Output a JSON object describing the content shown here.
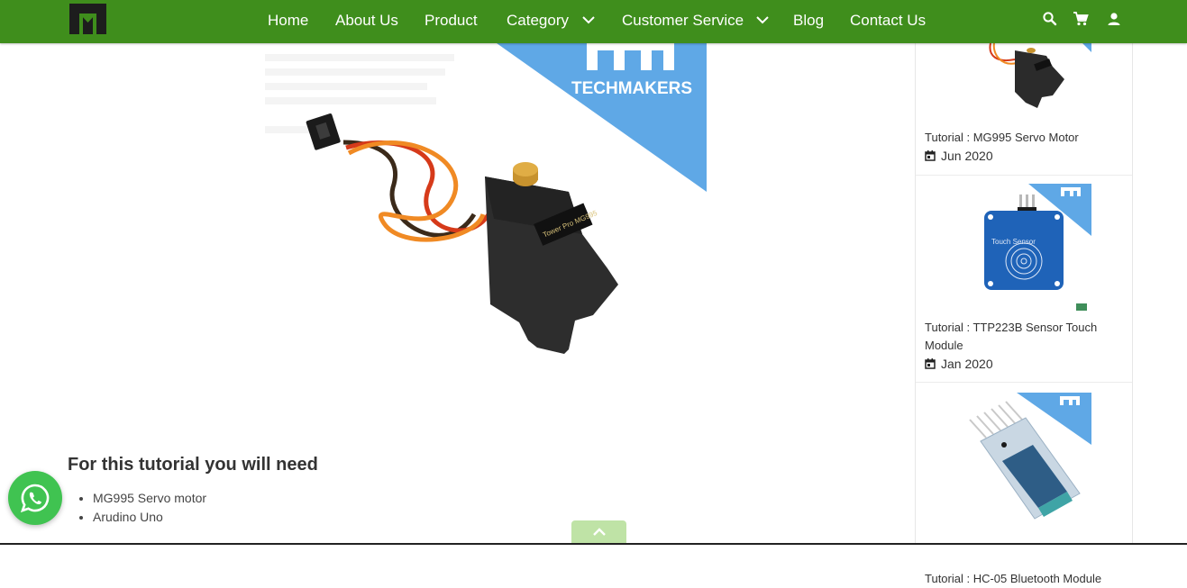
{
  "header": {
    "logo_alt": "TM",
    "nav": [
      "Home",
      "About Us",
      "Product",
      "Category",
      "Customer Service",
      "Blog",
      "Contact Us"
    ]
  },
  "hero": {
    "brand": "TECHMAKERS",
    "servo_label": "Tower Pro MG995"
  },
  "article": {
    "heading": "For this tutorial you will need",
    "items": [
      "MG995 Servo motor",
      "Arudino Uno"
    ]
  },
  "sidebar": {
    "cards": [
      {
        "title": "Tutorial : MG995 Servo Motor",
        "date": "Jun 2020"
      },
      {
        "title": "Tutorial : TTP223B Sensor Touch Module",
        "date": "Jan 2020",
        "thumb_label": "Touch Sensor"
      },
      {
        "title": "Tutorial : HC-05 Bluetooth Module",
        "date": ""
      }
    ]
  },
  "colors": {
    "header": "#3f8e1c",
    "techmakers_blue": "#5fa8e6",
    "whatsapp": "#40c351",
    "back_to_top": "#bfe3a6"
  },
  "icons": [
    "search-icon",
    "cart-icon",
    "user-icon",
    "chevron-down-icon",
    "calendar-icon",
    "whatsapp-icon",
    "chevron-up-icon"
  ]
}
